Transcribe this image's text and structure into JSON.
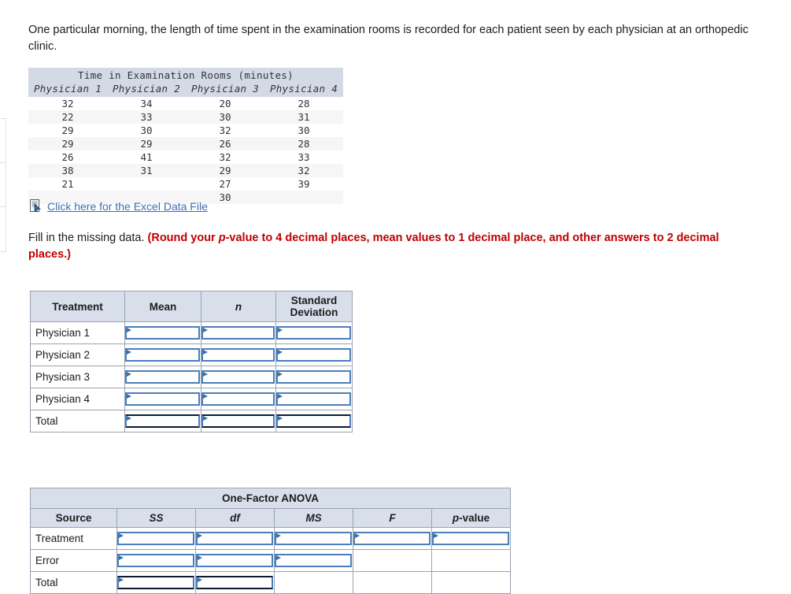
{
  "intro": {
    "text": "One particular morning, the length of time spent in the examination rooms is recorded for each patient seen by each physician at an orthopedic clinic."
  },
  "data_table": {
    "title": "Time in Examination Rooms (minutes)",
    "columns": [
      "Physician 1",
      "Physician 2",
      "Physician 3",
      "Physician 4"
    ],
    "rows": [
      [
        "32",
        "34",
        "20",
        "28"
      ],
      [
        "22",
        "33",
        "30",
        "31"
      ],
      [
        "29",
        "30",
        "32",
        "30"
      ],
      [
        "29",
        "29",
        "26",
        "28"
      ],
      [
        "26",
        "41",
        "32",
        "33"
      ],
      [
        "38",
        "31",
        "29",
        "32"
      ],
      [
        "21",
        "",
        "27",
        "39"
      ],
      [
        "",
        "",
        "30",
        ""
      ]
    ]
  },
  "excel": {
    "icon": "excel-document-icon",
    "link_label": "Click here for the Excel Data File"
  },
  "instruction": {
    "plain": "Fill in the missing data. ",
    "emphasis_pre": "(Round your ",
    "emphasis_italic": "p",
    "emphasis_post": "-value to 4 decimal places, mean values to 1 decimal place, and other answers to 2 decimal places.)"
  },
  "treatment_table": {
    "headers": [
      "Treatment",
      "Mean",
      "n",
      "Standard Deviation"
    ],
    "header_n_italic": "n",
    "rows": [
      {
        "label": "Physician 1",
        "inputs": [
          "",
          "",
          ""
        ]
      },
      {
        "label": "Physician 2",
        "inputs": [
          "",
          "",
          ""
        ]
      },
      {
        "label": "Physician 3",
        "inputs": [
          "",
          "",
          ""
        ]
      },
      {
        "label": "Physician 4",
        "inputs": [
          "",
          "",
          ""
        ]
      },
      {
        "label": "Total",
        "inputs": [
          "",
          "",
          ""
        ]
      }
    ]
  },
  "anova_table": {
    "title": "One-Factor ANOVA",
    "headers": [
      "Source",
      "SS",
      "df",
      "MS",
      "F",
      "p-value"
    ],
    "pvalue_italic": "p",
    "pvalue_rest": "-value",
    "rows": [
      {
        "label": "Treatment",
        "input_count": 5
      },
      {
        "label": "Error",
        "input_count": 3
      },
      {
        "label": "Total",
        "input_count": 2
      }
    ]
  },
  "colors": {
    "header_bg": "#d8dfeb",
    "data_header_bg": "#d3dae6",
    "input_border": "#4a7ebb",
    "link": "#3c6fb4",
    "emphasis": "#c00000"
  }
}
